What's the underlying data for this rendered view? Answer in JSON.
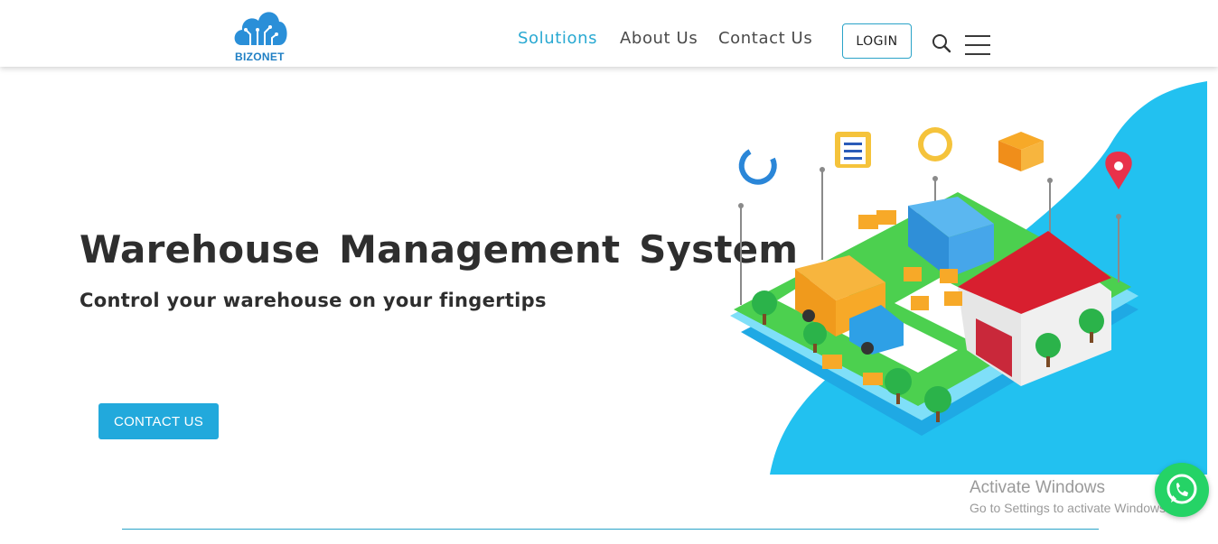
{
  "header": {
    "logo_text": "BIZONET",
    "nav": [
      "Solutions",
      "About Us",
      "Contact Us"
    ],
    "active_nav": "Solutions",
    "login_label": "LOGIN",
    "search_icon": "search-icon",
    "menu_icon": "hamburger-menu-icon"
  },
  "hero": {
    "title": "Warehouse Management System",
    "subtitle": "Control your warehouse on your fingertips",
    "cta_label": "CONTACT US"
  },
  "overlay": {
    "activate_title": "Activate Windows",
    "activate_sub": "Go to Settings to activate Windows."
  },
  "colors": {
    "accent": "#29a9d2",
    "button": "#22a9dc",
    "whatsapp": "#25d366",
    "blob": "#22c1f0",
    "text": "#2e2e2e"
  }
}
